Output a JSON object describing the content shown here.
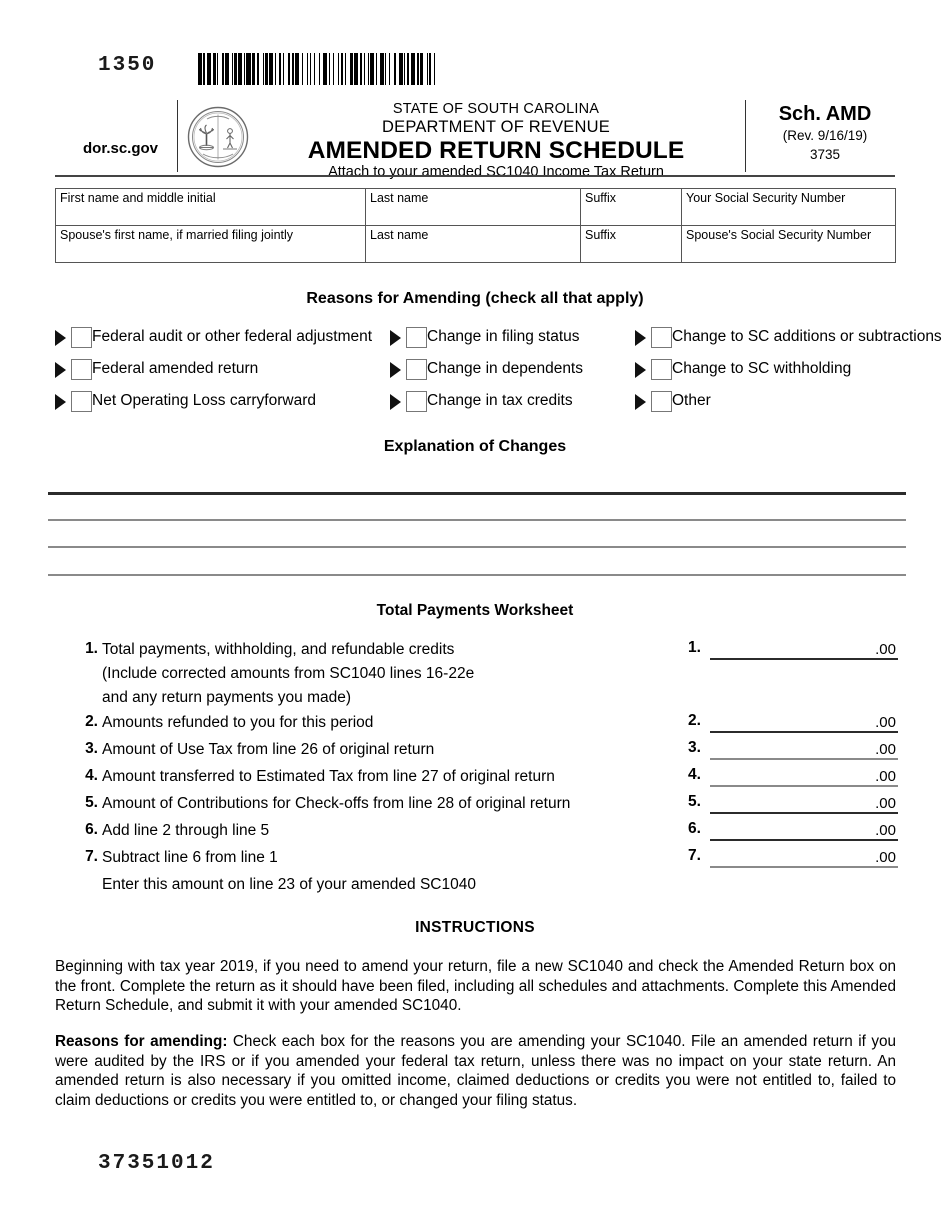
{
  "form_number": "1350",
  "footer_number": "37351012",
  "header": {
    "website": "dor.sc.gov",
    "state_line": "STATE OF SOUTH CAROLINA",
    "department_line": "DEPARTMENT OF REVENUE",
    "title": "AMENDED RETURN SCHEDULE",
    "subtitle": "Attach to your amended SC1040 Income Tax Return",
    "schedule_code": "Sch. AMD",
    "revision": "(Rev. 9/16/19)",
    "form_code": "3735",
    "seal_name": "south-carolina-state-seal",
    "barcode_name": "form-barcode"
  },
  "name_table": {
    "rows": [
      {
        "first_name": "First name and middle initial",
        "last_name": "Last name",
        "suffix": "Suffix",
        "ssn": "Your Social Security Number"
      },
      {
        "first_name": "Spouse's first name, if married filing jointly",
        "last_name": "Last name",
        "suffix": "Suffix",
        "ssn": "Spouse's Social Security Number"
      }
    ]
  },
  "reasons": {
    "title": "Reasons for Amending (check all that apply)",
    "rows": [
      {
        "col1": "Federal audit or other federal adjustment",
        "col2": "Change in filing status",
        "col3": "Change to SC additions or subtractions"
      },
      {
        "col1": "Federal amended return",
        "col2": "Change in dependents",
        "col3": "Change to SC withholding"
      },
      {
        "col1": "Net Operating Loss carryforward",
        "col2": "Change in tax credits",
        "col3": "Other"
      }
    ]
  },
  "explanation": {
    "title": "Explanation of Changes"
  },
  "worksheet": {
    "title": "Total Payments Worksheet",
    "cents": ".00",
    "lines": [
      {
        "num": "1.",
        "amt_num": "1.",
        "text_lines": [
          "Total payments, withholding, and refundable credits",
          "(Include corrected amounts from SC1040 lines 16-22e",
          "and any return payments you made)"
        ]
      },
      {
        "num": "2.",
        "amt_num": "2.",
        "text_lines": [
          "Amounts refunded to you for this period"
        ]
      },
      {
        "num": "3.",
        "amt_num": "3.",
        "text_lines": [
          "Amount of Use Tax from line 26 of original return"
        ]
      },
      {
        "num": "4.",
        "amt_num": "4.",
        "text_lines": [
          "Amount transferred to Estimated Tax from line 27 of original return"
        ]
      },
      {
        "num": "5.",
        "amt_num": "5.",
        "text_lines": [
          "Amount of Contributions for Check-offs from line 28 of original return"
        ]
      },
      {
        "num": "6.",
        "amt_num": "6.",
        "text_lines": [
          "Add line 2 through line 5"
        ]
      },
      {
        "num": "7.",
        "amt_num": "7.",
        "text_lines": [
          "Subtract line 6 from line 1",
          "Enter this amount on line 23 of your amended SC1040"
        ]
      }
    ]
  },
  "instructions": {
    "title": "INSTRUCTIONS",
    "paragraph1": "Beginning with tax year 2019, if you need to amend your return, file a new SC1040 and check the Amended Return box on the front. Complete the return as it should have been filed, including all schedules and attachments. Complete this Amended Return Schedule, and submit it with your amended SC1040.",
    "paragraph2_lead": "Reasons for amending:",
    "paragraph2": " Check each box for the reasons you are amending your SC1040. File an amended return if you were audited by the IRS or if you amended your federal tax return, unless there was no impact on your state return. An amended return is also necessary if you omitted income, claimed deductions or credits you were not entitled to, failed to claim deductions or credits you were entitled to, or changed your filing status."
  },
  "colors": {
    "ink": "#000000",
    "rule_dark": "#2b2b2b",
    "rule_light": "#8a8a8a",
    "box_border": "#777777"
  }
}
